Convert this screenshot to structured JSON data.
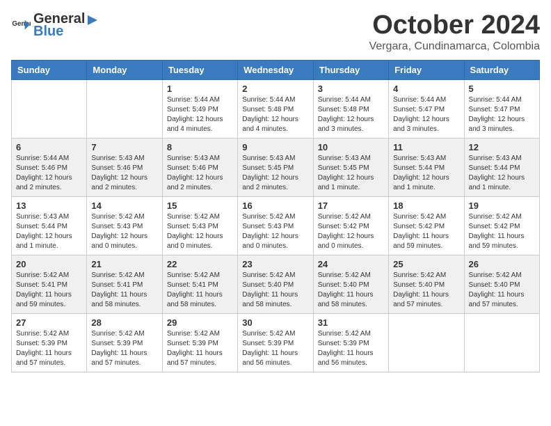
{
  "logo": {
    "text_general": "General",
    "text_blue": "Blue"
  },
  "header": {
    "month": "October 2024",
    "location": "Vergara, Cundinamarca, Colombia"
  },
  "weekdays": [
    "Sunday",
    "Monday",
    "Tuesday",
    "Wednesday",
    "Thursday",
    "Friday",
    "Saturday"
  ],
  "weeks": [
    [
      {
        "day": "",
        "info": ""
      },
      {
        "day": "",
        "info": ""
      },
      {
        "day": "1",
        "info": "Sunrise: 5:44 AM\nSunset: 5:49 PM\nDaylight: 12 hours and 4 minutes."
      },
      {
        "day": "2",
        "info": "Sunrise: 5:44 AM\nSunset: 5:48 PM\nDaylight: 12 hours and 4 minutes."
      },
      {
        "day": "3",
        "info": "Sunrise: 5:44 AM\nSunset: 5:48 PM\nDaylight: 12 hours and 3 minutes."
      },
      {
        "day": "4",
        "info": "Sunrise: 5:44 AM\nSunset: 5:47 PM\nDaylight: 12 hours and 3 minutes."
      },
      {
        "day": "5",
        "info": "Sunrise: 5:44 AM\nSunset: 5:47 PM\nDaylight: 12 hours and 3 minutes."
      }
    ],
    [
      {
        "day": "6",
        "info": "Sunrise: 5:44 AM\nSunset: 5:46 PM\nDaylight: 12 hours and 2 minutes."
      },
      {
        "day": "7",
        "info": "Sunrise: 5:43 AM\nSunset: 5:46 PM\nDaylight: 12 hours and 2 minutes."
      },
      {
        "day": "8",
        "info": "Sunrise: 5:43 AM\nSunset: 5:46 PM\nDaylight: 12 hours and 2 minutes."
      },
      {
        "day": "9",
        "info": "Sunrise: 5:43 AM\nSunset: 5:45 PM\nDaylight: 12 hours and 2 minutes."
      },
      {
        "day": "10",
        "info": "Sunrise: 5:43 AM\nSunset: 5:45 PM\nDaylight: 12 hours and 1 minute."
      },
      {
        "day": "11",
        "info": "Sunrise: 5:43 AM\nSunset: 5:44 PM\nDaylight: 12 hours and 1 minute."
      },
      {
        "day": "12",
        "info": "Sunrise: 5:43 AM\nSunset: 5:44 PM\nDaylight: 12 hours and 1 minute."
      }
    ],
    [
      {
        "day": "13",
        "info": "Sunrise: 5:43 AM\nSunset: 5:44 PM\nDaylight: 12 hours and 1 minute."
      },
      {
        "day": "14",
        "info": "Sunrise: 5:42 AM\nSunset: 5:43 PM\nDaylight: 12 hours and 0 minutes."
      },
      {
        "day": "15",
        "info": "Sunrise: 5:42 AM\nSunset: 5:43 PM\nDaylight: 12 hours and 0 minutes."
      },
      {
        "day": "16",
        "info": "Sunrise: 5:42 AM\nSunset: 5:43 PM\nDaylight: 12 hours and 0 minutes."
      },
      {
        "day": "17",
        "info": "Sunrise: 5:42 AM\nSunset: 5:42 PM\nDaylight: 12 hours and 0 minutes."
      },
      {
        "day": "18",
        "info": "Sunrise: 5:42 AM\nSunset: 5:42 PM\nDaylight: 11 hours and 59 minutes."
      },
      {
        "day": "19",
        "info": "Sunrise: 5:42 AM\nSunset: 5:42 PM\nDaylight: 11 hours and 59 minutes."
      }
    ],
    [
      {
        "day": "20",
        "info": "Sunrise: 5:42 AM\nSunset: 5:41 PM\nDaylight: 11 hours and 59 minutes."
      },
      {
        "day": "21",
        "info": "Sunrise: 5:42 AM\nSunset: 5:41 PM\nDaylight: 11 hours and 58 minutes."
      },
      {
        "day": "22",
        "info": "Sunrise: 5:42 AM\nSunset: 5:41 PM\nDaylight: 11 hours and 58 minutes."
      },
      {
        "day": "23",
        "info": "Sunrise: 5:42 AM\nSunset: 5:40 PM\nDaylight: 11 hours and 58 minutes."
      },
      {
        "day": "24",
        "info": "Sunrise: 5:42 AM\nSunset: 5:40 PM\nDaylight: 11 hours and 58 minutes."
      },
      {
        "day": "25",
        "info": "Sunrise: 5:42 AM\nSunset: 5:40 PM\nDaylight: 11 hours and 57 minutes."
      },
      {
        "day": "26",
        "info": "Sunrise: 5:42 AM\nSunset: 5:40 PM\nDaylight: 11 hours and 57 minutes."
      }
    ],
    [
      {
        "day": "27",
        "info": "Sunrise: 5:42 AM\nSunset: 5:39 PM\nDaylight: 11 hours and 57 minutes."
      },
      {
        "day": "28",
        "info": "Sunrise: 5:42 AM\nSunset: 5:39 PM\nDaylight: 11 hours and 57 minutes."
      },
      {
        "day": "29",
        "info": "Sunrise: 5:42 AM\nSunset: 5:39 PM\nDaylight: 11 hours and 57 minutes."
      },
      {
        "day": "30",
        "info": "Sunrise: 5:42 AM\nSunset: 5:39 PM\nDaylight: 11 hours and 56 minutes."
      },
      {
        "day": "31",
        "info": "Sunrise: 5:42 AM\nSunset: 5:39 PM\nDaylight: 11 hours and 56 minutes."
      },
      {
        "day": "",
        "info": ""
      },
      {
        "day": "",
        "info": ""
      }
    ]
  ]
}
